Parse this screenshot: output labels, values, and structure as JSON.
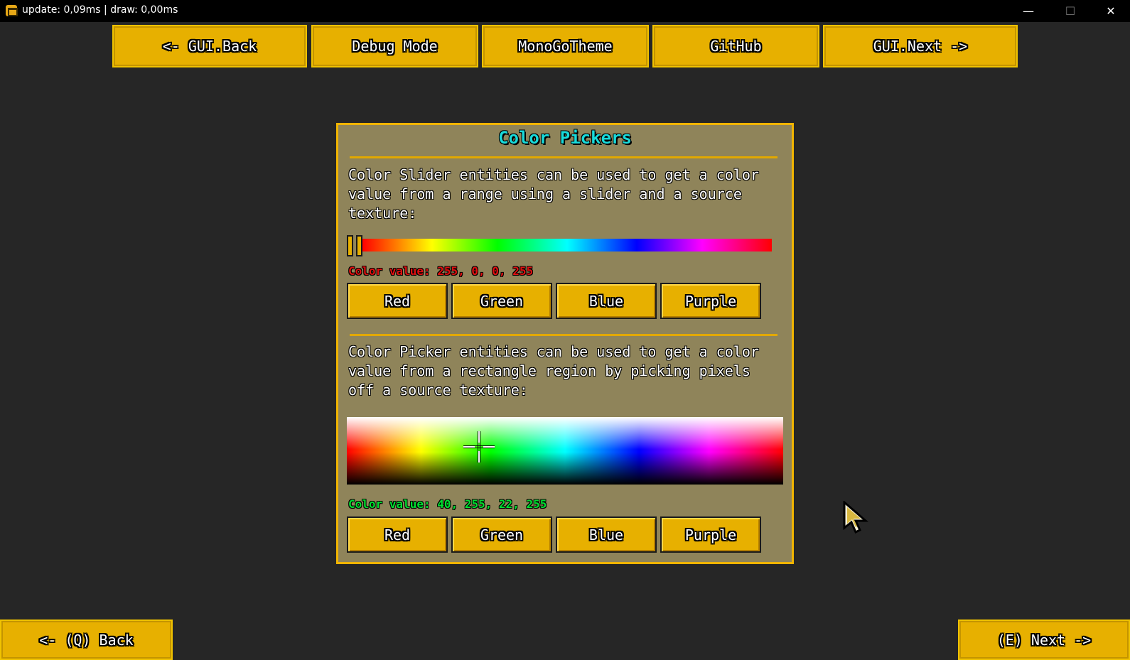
{
  "window": {
    "title": "update: 0,09ms | draw: 0,00ms",
    "controls": {
      "minimize": "—",
      "maximize": "☐",
      "close": "✕"
    }
  },
  "top_nav": [
    {
      "label": "<- GUI.Back"
    },
    {
      "label": "Debug Mode"
    },
    {
      "label": "MonoGoTheme"
    },
    {
      "label": "GitHub"
    },
    {
      "label": "GUI.Next ->"
    }
  ],
  "panel": {
    "title": "Color Pickers",
    "slider_section": {
      "description": "Color Slider entities can be used to get a color value from a range using a slider and a source texture:",
      "slider_value_fraction": 0.0,
      "value_text": "Color value: 255, 0, 0, 255",
      "value_color": "#ff0000",
      "buttons": [
        {
          "label": "Red"
        },
        {
          "label": "Green"
        },
        {
          "label": "Blue"
        },
        {
          "label": "Purple"
        }
      ]
    },
    "picker_section": {
      "description": "Color Picker entities can be used to get a color value from a rectangle region by picking pixels off a source texture:",
      "value_text": "Color value: 40, 255, 22, 255",
      "value_color": "#28ff16",
      "buttons": [
        {
          "label": "Red"
        },
        {
          "label": "Green"
        },
        {
          "label": "Blue"
        },
        {
          "label": "Purple"
        }
      ]
    }
  },
  "bottom_nav": {
    "back_label": "<- (Q) Back",
    "next_label": "(E) Next ->"
  },
  "colors": {
    "accent": "#e7b000",
    "panel_bg": "#8f845a",
    "background": "#262626",
    "title_color": "#18dada"
  }
}
